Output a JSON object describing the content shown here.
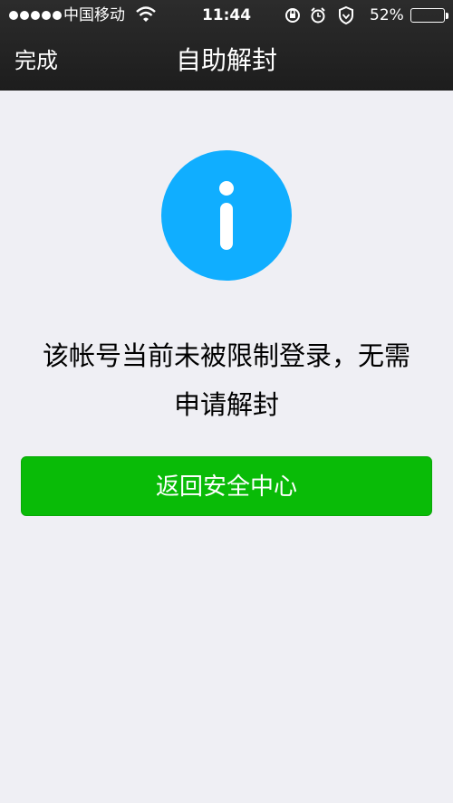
{
  "status_bar": {
    "carrier": "中国移动",
    "time": "11:44",
    "battery_percent": "52%",
    "battery_level": 0.52,
    "icons": [
      "signal-dots-icon",
      "wifi-icon",
      "rotation-lock-icon",
      "alarm-icon",
      "shield-icon",
      "battery-icon"
    ]
  },
  "nav": {
    "done_label": "完成",
    "title": "自助解封"
  },
  "content": {
    "icon": "info-icon",
    "icon_color": "#10aeff",
    "message_line1": "该帐号当前未被限制登录，无需",
    "message_line2": "申请解封",
    "button_label": "返回安全中心",
    "button_color": "#09bb07"
  }
}
